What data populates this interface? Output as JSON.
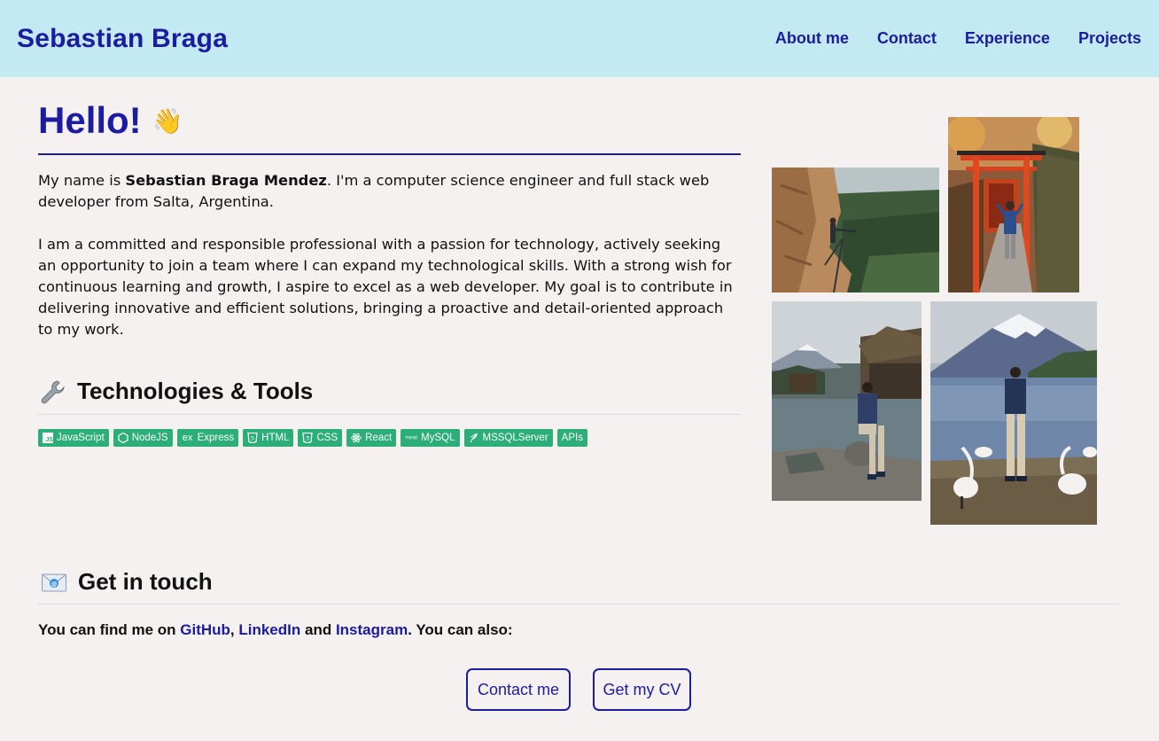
{
  "header": {
    "brand": "Sebastian Braga",
    "nav": [
      "About me",
      "Contact",
      "Experience",
      "Projects"
    ]
  },
  "hero": {
    "title": "Hello!",
    "wave_icon": "waving-hand-icon",
    "intro_before": "My name is ",
    "intro_name": "Sebastian Braga Mendez",
    "intro_after": ". I'm a computer science engineer and full stack web developer from Salta, Argentina.",
    "paragraph": "I am a committed and responsible professional with a passion for technology, actively seeking an opportunity to join a team where I can expand my technological skills. With a strong wish for continuous learning and growth, I aspire to excel as a web developer. My goal is to contribute in delivering innovative and efficient solutions, bringing a proactive and detail-oriented approach to my work."
  },
  "tech": {
    "title": "Technologies & Tools",
    "icon": "wrench-icon",
    "badges": [
      {
        "label": "JavaScript",
        "icon": "javascript-icon"
      },
      {
        "label": "NodeJS",
        "icon": "nodejs-icon"
      },
      {
        "label": "Express",
        "icon": "express-icon"
      },
      {
        "label": "HTML",
        "icon": "html5-icon"
      },
      {
        "label": "CSS",
        "icon": "css3-icon"
      },
      {
        "label": "React",
        "icon": "react-icon"
      },
      {
        "label": "MySQL",
        "icon": "mysql-icon"
      },
      {
        "label": "MSSQLServer",
        "icon": "mssql-icon"
      },
      {
        "label": "APIs",
        "icon": ""
      }
    ],
    "badge_color": "#2bae78"
  },
  "contact": {
    "title": "Get in touch",
    "icon": "envelope-icon",
    "find_prefix": "You can find me on ",
    "github": "GitHub",
    "sep1": ", ",
    "linkedin": "LinkedIn",
    "sep2": " and ",
    "instagram": "Instagram",
    "find_suffix": ". You can also:",
    "contact_button": "Contact me",
    "cv_button": "Get my CV"
  },
  "photos": [
    "cliff-trail-photo",
    "torii-gate-photo",
    "mount-fuji-village-photo",
    "mount-fuji-lake-swans-photo"
  ],
  "colors": {
    "accent": "#1c1ca0",
    "header_bg": "#c3e9f2",
    "page_bg": "#f6f1f1"
  }
}
